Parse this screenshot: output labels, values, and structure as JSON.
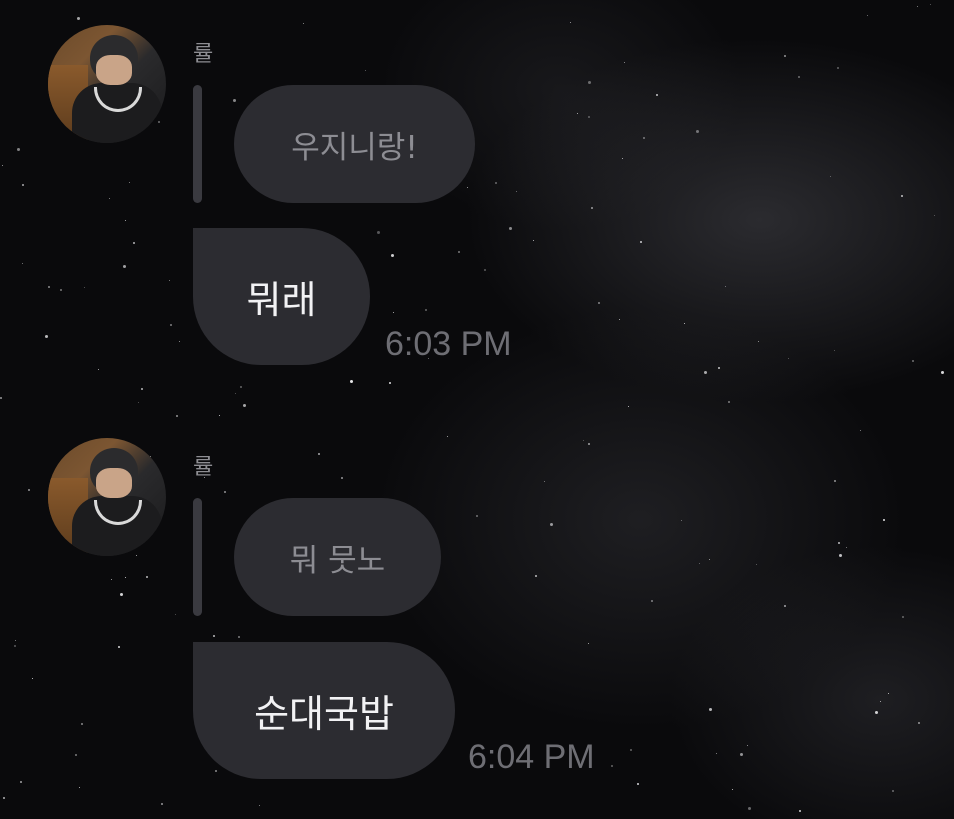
{
  "messages": [
    {
      "sender": "률",
      "avatar_icon": "profile-photo",
      "quoted_text": "우지니랑!",
      "text": "뭐래",
      "time": "6:03 PM"
    },
    {
      "sender": "률",
      "avatar_icon": "profile-photo",
      "quoted_text": "뭐 뭇노",
      "text": "순대국밥",
      "time": "6:04 PM"
    }
  ],
  "colors": {
    "background": "#0a0a0c",
    "bubble": "#2c2c31",
    "quote_bar": "#3a3a40",
    "sender_name": "#8e8e93",
    "timestamp": "#6e6e74"
  }
}
